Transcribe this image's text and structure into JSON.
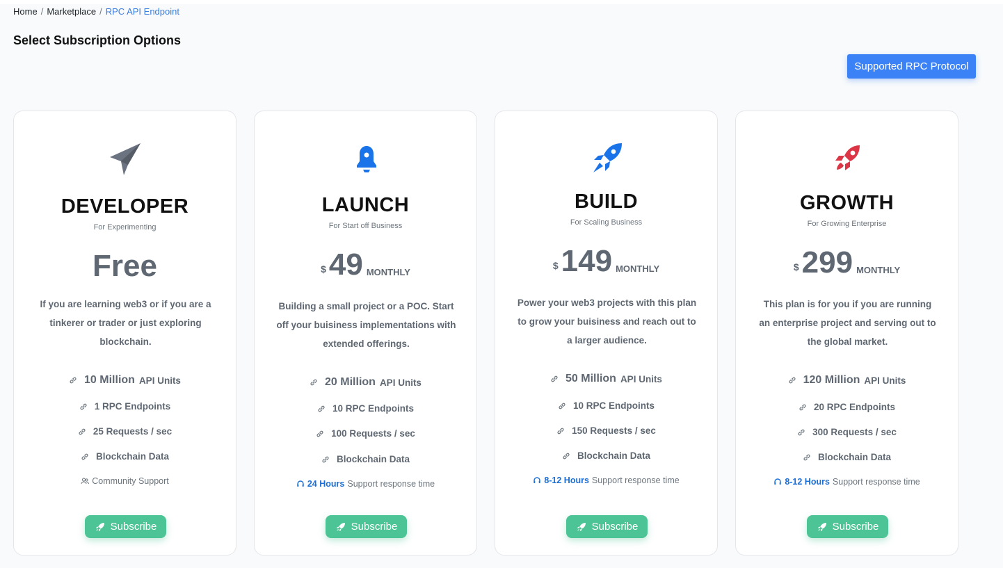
{
  "breadcrumb": {
    "items": [
      "Home",
      "Marketplace",
      "RPC API Endpoint"
    ],
    "separator": "/"
  },
  "page_title": "Select Subscription Options",
  "protocol_button": "Supported RPC Protocol",
  "colors": {
    "accent_blue": "#3b82f6",
    "subscribe_green": "#4cc495",
    "highlight_blue": "#1a6fd8",
    "developer_icon": "#6b7280",
    "launch_icon": "#1a73e8",
    "build_icon": "#1a73e8",
    "growth_icon": "#dc3545"
  },
  "plans": [
    {
      "icon": "paper-plane-icon",
      "name": "DEVELOPER",
      "subtitle": "For Experimenting",
      "price_label": "Free",
      "description": "If you are learning web3 or if you are a tinkerer or trader or just exploring blockchain.",
      "api_units_value": "10 Million",
      "api_units_label": "API Units",
      "features": [
        "1 RPC Endpoints",
        "25 Requests / sec",
        "Blockchain Data"
      ],
      "support_text": "Community Support",
      "subscribe_label": "Subscribe"
    },
    {
      "icon": "bell-icon",
      "name": "LAUNCH",
      "subtitle": "For Start off Business",
      "currency": "$",
      "price": "49",
      "period": "MONTHLY",
      "description": "Building a small project or a POC. Start off your buisiness implementations with extended offerings.",
      "api_units_value": "20 Million",
      "api_units_label": "API Units",
      "features": [
        "10 RPC Endpoints",
        "100 Requests / sec",
        "Blockchain Data"
      ],
      "support_highlight": "24 Hours",
      "support_text": "Support response time",
      "subscribe_label": "Subscribe"
    },
    {
      "icon": "rocket-icon",
      "name": "BUILD",
      "subtitle": "For Scaling Business",
      "currency": "$",
      "price": "149",
      "period": "MONTHLY",
      "description": "Power your web3 projects with this plan to grow your buisiness and reach out to a larger audience.",
      "api_units_value": "50 Million",
      "api_units_label": "API Units",
      "features": [
        "10 RPC Endpoints",
        "150 Requests / sec",
        "Blockchain Data"
      ],
      "support_highlight": "8-12 Hours",
      "support_text": "Support response time",
      "subscribe_label": "Subscribe"
    },
    {
      "icon": "rocket-launch-icon",
      "name": "GROWTH",
      "subtitle": "For Growing Enterprise",
      "currency": "$",
      "price": "299",
      "period": "MONTHLY",
      "description": "This plan is for you if you are running an enterprise project and serving out to the global market.",
      "api_units_value": "120 Million",
      "api_units_label": "API Units",
      "features": [
        "20 RPC Endpoints",
        "300 Requests / sec",
        "Blockchain Data"
      ],
      "support_highlight": "8-12 Hours",
      "support_text": "Support response time",
      "subscribe_label": "Subscribe"
    }
  ]
}
